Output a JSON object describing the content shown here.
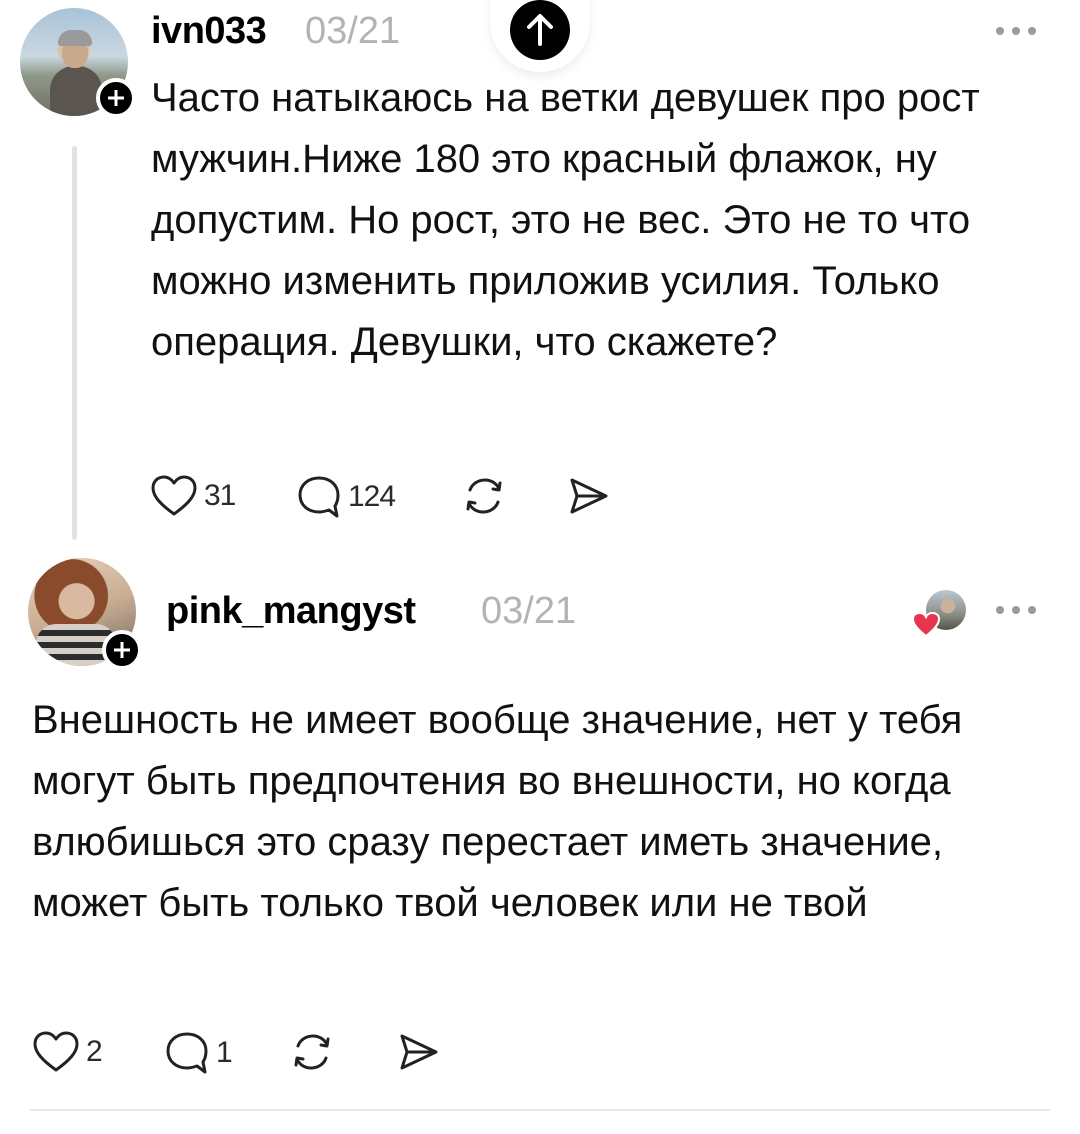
{
  "scroll_top": {
    "icon": "arrow-up-icon"
  },
  "posts": [
    {
      "username": "ivn033",
      "date": "03/21",
      "text": "Часто натыкаюсь на ветки девушек про рост мужчин.Ниже 180 это красный флажок, ну допустим. Но рост, это не вес. Это не то что можно изменить приложив усилия. Только операция. Девушки, что скажете?",
      "likes": "31",
      "replies": "124"
    },
    {
      "username": "pink_mangyst",
      "date": "03/21",
      "text": "Внешность не имеет вообще значение, нет у тебя могут быть предпочтения во внешности, но когда влюбишься это сразу перестает иметь значение, может быть только твой человек или не твой",
      "likes": "2",
      "replies": "1"
    }
  ],
  "colors": {
    "text": "#111111",
    "muted": "#b3b3b3",
    "like_heart": "#e8344e"
  }
}
